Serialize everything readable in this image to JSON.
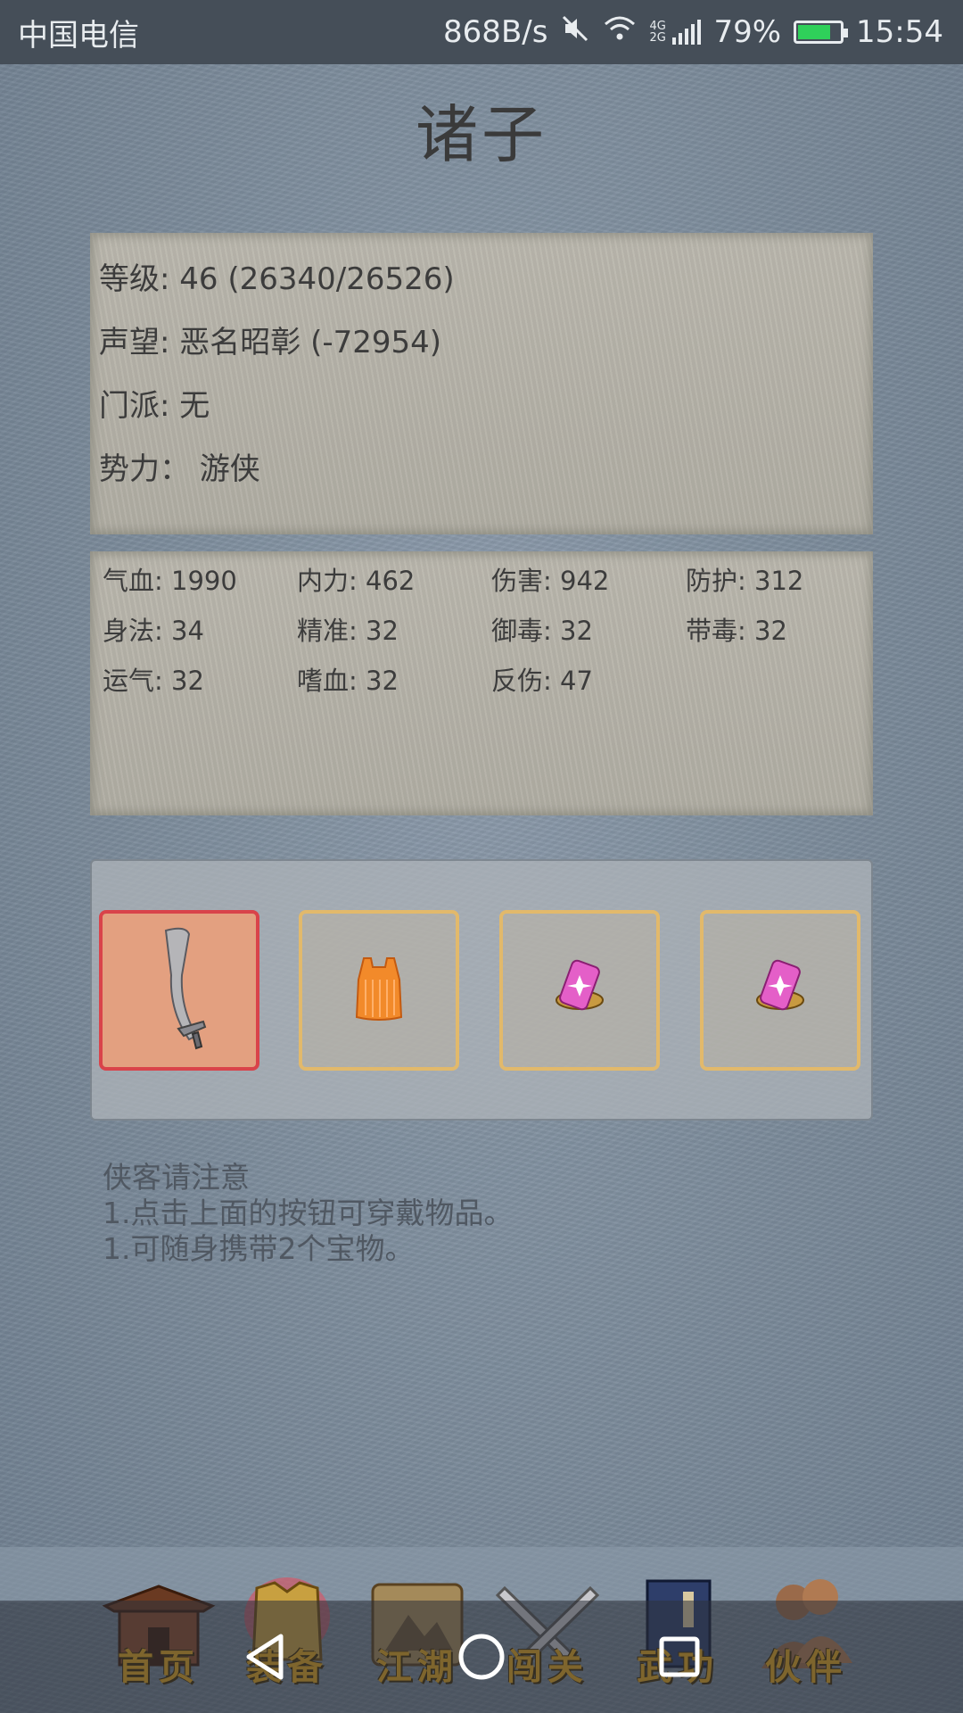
{
  "status_bar": {
    "carrier": "中国电信",
    "network_speed": "868B/s",
    "battery_percent": "79%",
    "battery_level": 0.79,
    "time": "15:54",
    "network_type": "4G 2G",
    "icons": [
      "mute-icon",
      "wifi-icon",
      "signal-icon",
      "battery-icon"
    ]
  },
  "page": {
    "title": "诸子"
  },
  "info": {
    "level": "等级: 46 (26340/26526)",
    "reputation": "声望: 恶名昭彰 (-72954)",
    "sect": "门派: 无",
    "faction": "势力：  游侠"
  },
  "stats": [
    "气血: 1990",
    "内力: 462",
    "伤害: 942",
    "防护: 312",
    "身法: 34",
    "精准: 32",
    "御毒: 32",
    "带毒: 32",
    "运气: 32",
    "嗜血: 32",
    "反伤: 47"
  ],
  "equipment": [
    {
      "icon": "sword-icon",
      "active": true
    },
    {
      "icon": "armor-icon",
      "active": false
    },
    {
      "icon": "treasure-icon",
      "active": false
    },
    {
      "icon": "treasure-icon",
      "active": false
    }
  ],
  "notice": {
    "title": "侠客请注意",
    "line1": "1.点击上面的按钮可穿戴物品。",
    "line2": "1.可随身携带2个宝物。"
  },
  "nav": {
    "items": [
      {
        "label": "首页",
        "icon": "home-icon"
      },
      {
        "label": "装备",
        "icon": "equipment-icon"
      },
      {
        "label": "江湖",
        "icon": "world-map-icon"
      },
      {
        "label": "闯关",
        "icon": "swords-icon"
      },
      {
        "label": "武功",
        "icon": "book-icon"
      },
      {
        "label": "伙伴",
        "icon": "partners-icon"
      }
    ]
  },
  "colors": {
    "label_gold": "#e0a51d",
    "active_slot_border": "#d9434a",
    "slot_border": "#e2b96b"
  }
}
